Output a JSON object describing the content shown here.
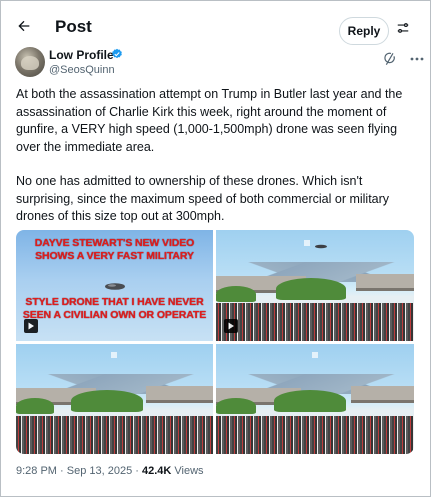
{
  "header": {
    "title": "Post",
    "reply_label": "Reply"
  },
  "author": {
    "name": "Low Profile",
    "handle": "@SeosQuinn"
  },
  "post": {
    "paragraphs": [
      "At both the assassination attempt on Trump in Butler last year and the assassination of Charlie Kirk this week, right around the moment of gunfire, a VERY high speed (1,000-1,500mph) drone was seen flying over the immediate area.",
      "No one has admitted to ownership of these drones. Which isn't surprising, since the maximum speed of both commercial or military drones of this size top out at 300mph."
    ],
    "media_overlay_top": "DAYVE STEWART'S NEW VIDEO SHOWS A VERY FAST MILITARY",
    "media_overlay_bottom": "STYLE DRONE THAT I HAVE NEVER SEEN A CIVILIAN OWN OR OPERATE"
  },
  "meta": {
    "time": "9:28 PM",
    "sep1": " · ",
    "date": "Sep 13, 2025",
    "sep2": " · ",
    "views_count": "42.4K",
    "views_label": " Views"
  },
  "icons": [
    "back-arrow-icon",
    "adjust-icon",
    "verified-badge-icon",
    "grok-icon",
    "more-icon",
    "play-icon"
  ],
  "colors": {
    "verified": "#1d9bf0",
    "overlay_text": "#e01d1d",
    "secondary_text": "#536471"
  }
}
